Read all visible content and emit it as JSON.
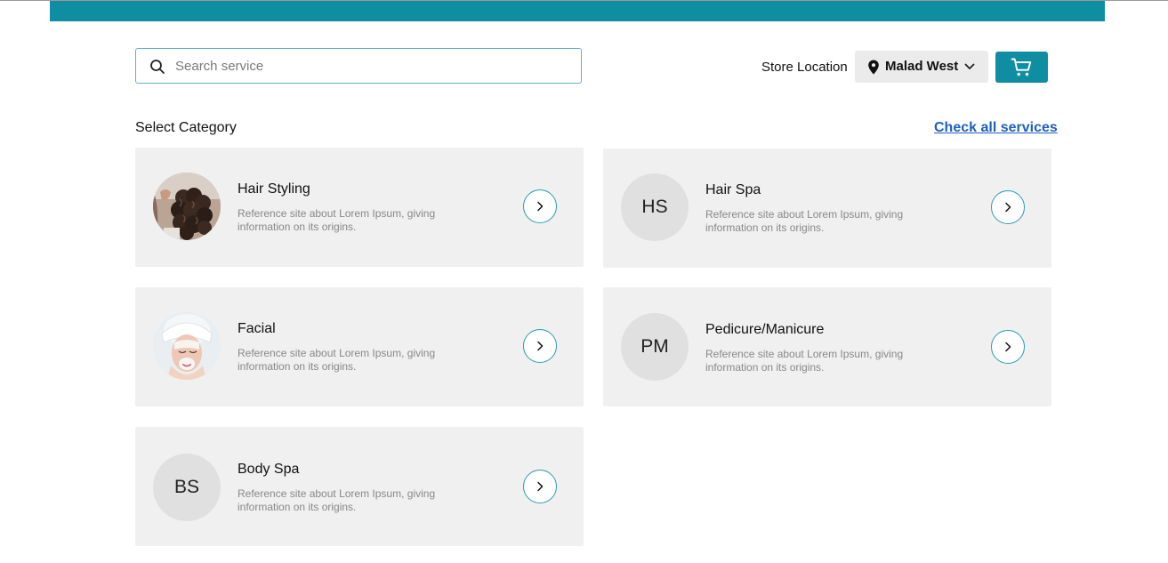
{
  "header": {
    "accent_color": "#0f8ea2",
    "search": {
      "placeholder": "Search service",
      "value": "",
      "icon": "search-icon"
    },
    "store_location_label": "Store Location",
    "location": {
      "value": "Malad West",
      "icon": "location-pin-icon",
      "dropdown_icon": "chevron-down-icon"
    },
    "cart": {
      "icon": "cart-icon"
    }
  },
  "categories_section": {
    "title": "Select Category",
    "check_all_link": "Check all services",
    "link_color": "#1f5fbf",
    "cards": [
      {
        "title": "Hair Styling",
        "description": "Reference site about Lorem Ipsum, giving information on its origins.",
        "avatar_type": "photo",
        "avatar_subject": "curly hair being styled"
      },
      {
        "title": "Hair Spa",
        "description": "Reference site about Lorem Ipsum, giving information on its origins.",
        "avatar_type": "initials",
        "initials": "HS"
      },
      {
        "title": "Facial",
        "description": "Reference site about Lorem Ipsum, giving information on its origins.",
        "avatar_type": "photo",
        "avatar_subject": "woman with face mask and towel"
      },
      {
        "title": "Pedicure/Manicure",
        "description": "Reference site about Lorem Ipsum, giving information on its origins.",
        "avatar_type": "initials",
        "initials": "PM"
      },
      {
        "title": "Body Spa",
        "description": "Reference site about Lorem Ipsum, giving information on its origins.",
        "avatar_type": "initials",
        "initials": "BS"
      }
    ]
  }
}
